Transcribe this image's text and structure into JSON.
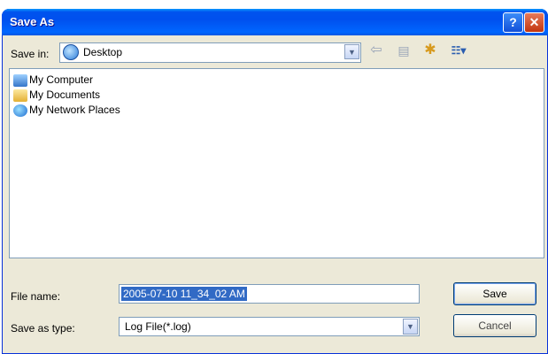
{
  "window": {
    "title": "Save As",
    "help_glyph": "?",
    "close_glyph": "✕"
  },
  "toolbar": {
    "save_in_label": "Save in:",
    "save_in_value": "Desktop",
    "icons": [
      "desktop-folder-icon",
      "back-icon",
      "up-folder-icon",
      "new-folder-icon",
      "views-menu-icon"
    ]
  },
  "file_list": {
    "items": [
      {
        "label": "My Computer",
        "icon": "my-computer-icon"
      },
      {
        "label": "My Documents",
        "icon": "my-documents-icon"
      },
      {
        "label": "My Network Places",
        "icon": "my-network-places-icon"
      }
    ]
  },
  "form": {
    "file_name_label": "File name:",
    "file_name_value": "2005-07-10 11_34_02 AM",
    "save_as_type_label": "Save as type:",
    "save_as_type_value": "Log File(*.log)"
  },
  "buttons": {
    "save": "Save",
    "cancel": "Cancel"
  },
  "colors": {
    "titlebar": "#0054e3",
    "selection": "#316ac5",
    "dialog_bg": "#ece9d8"
  }
}
